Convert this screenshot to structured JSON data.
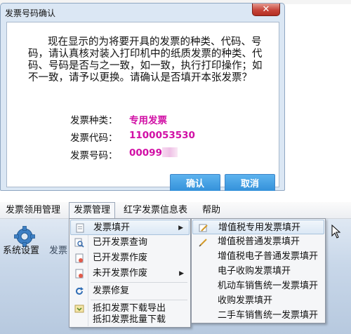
{
  "dialog": {
    "title": "发票号码确认",
    "close_label": "✕",
    "message": "现在显示的为将要开具的发票的种类、代码、号码，请认真核对装入打印机中的纸质发票的种类、代码、号码是否与之一致，如一致，执行打印操作；如不一致，请予以更换。请确认是否填开本张发票？",
    "fields": [
      {
        "label": "发票种类：",
        "value": "专用发票"
      },
      {
        "label": "发票代码：",
        "value": "1100053530"
      },
      {
        "label": "发票号码：",
        "value": "00099"
      }
    ],
    "confirm_label": "确认",
    "cancel_label": "取消"
  },
  "menubar": {
    "items": [
      "发票领用管理",
      "发票管理",
      "红字发票信息表",
      "帮助"
    ]
  },
  "toolbar": {
    "items": [
      "系统设置",
      "发票"
    ]
  },
  "dropdown": {
    "items": [
      "发票填开",
      "已开发票查询",
      "已开发票作废",
      "未开发票作废",
      "发票修复",
      "抵扣发票下载导出",
      "抵扣发票批量下载"
    ],
    "submenu_arrow": "▶"
  },
  "submenu": {
    "items": [
      "增值税专用发票填开",
      "增值税普通发票填开",
      "增值税电子普通发票填开",
      "电子收购发票填开",
      "机动车销售统一发票填开",
      "收购发票填开",
      "二手车销售统一发票填开"
    ]
  },
  "colors": {
    "accent_magenta": "#d10fa5",
    "button_blue": "#2b8ad6",
    "close_red": "#c7453a"
  }
}
